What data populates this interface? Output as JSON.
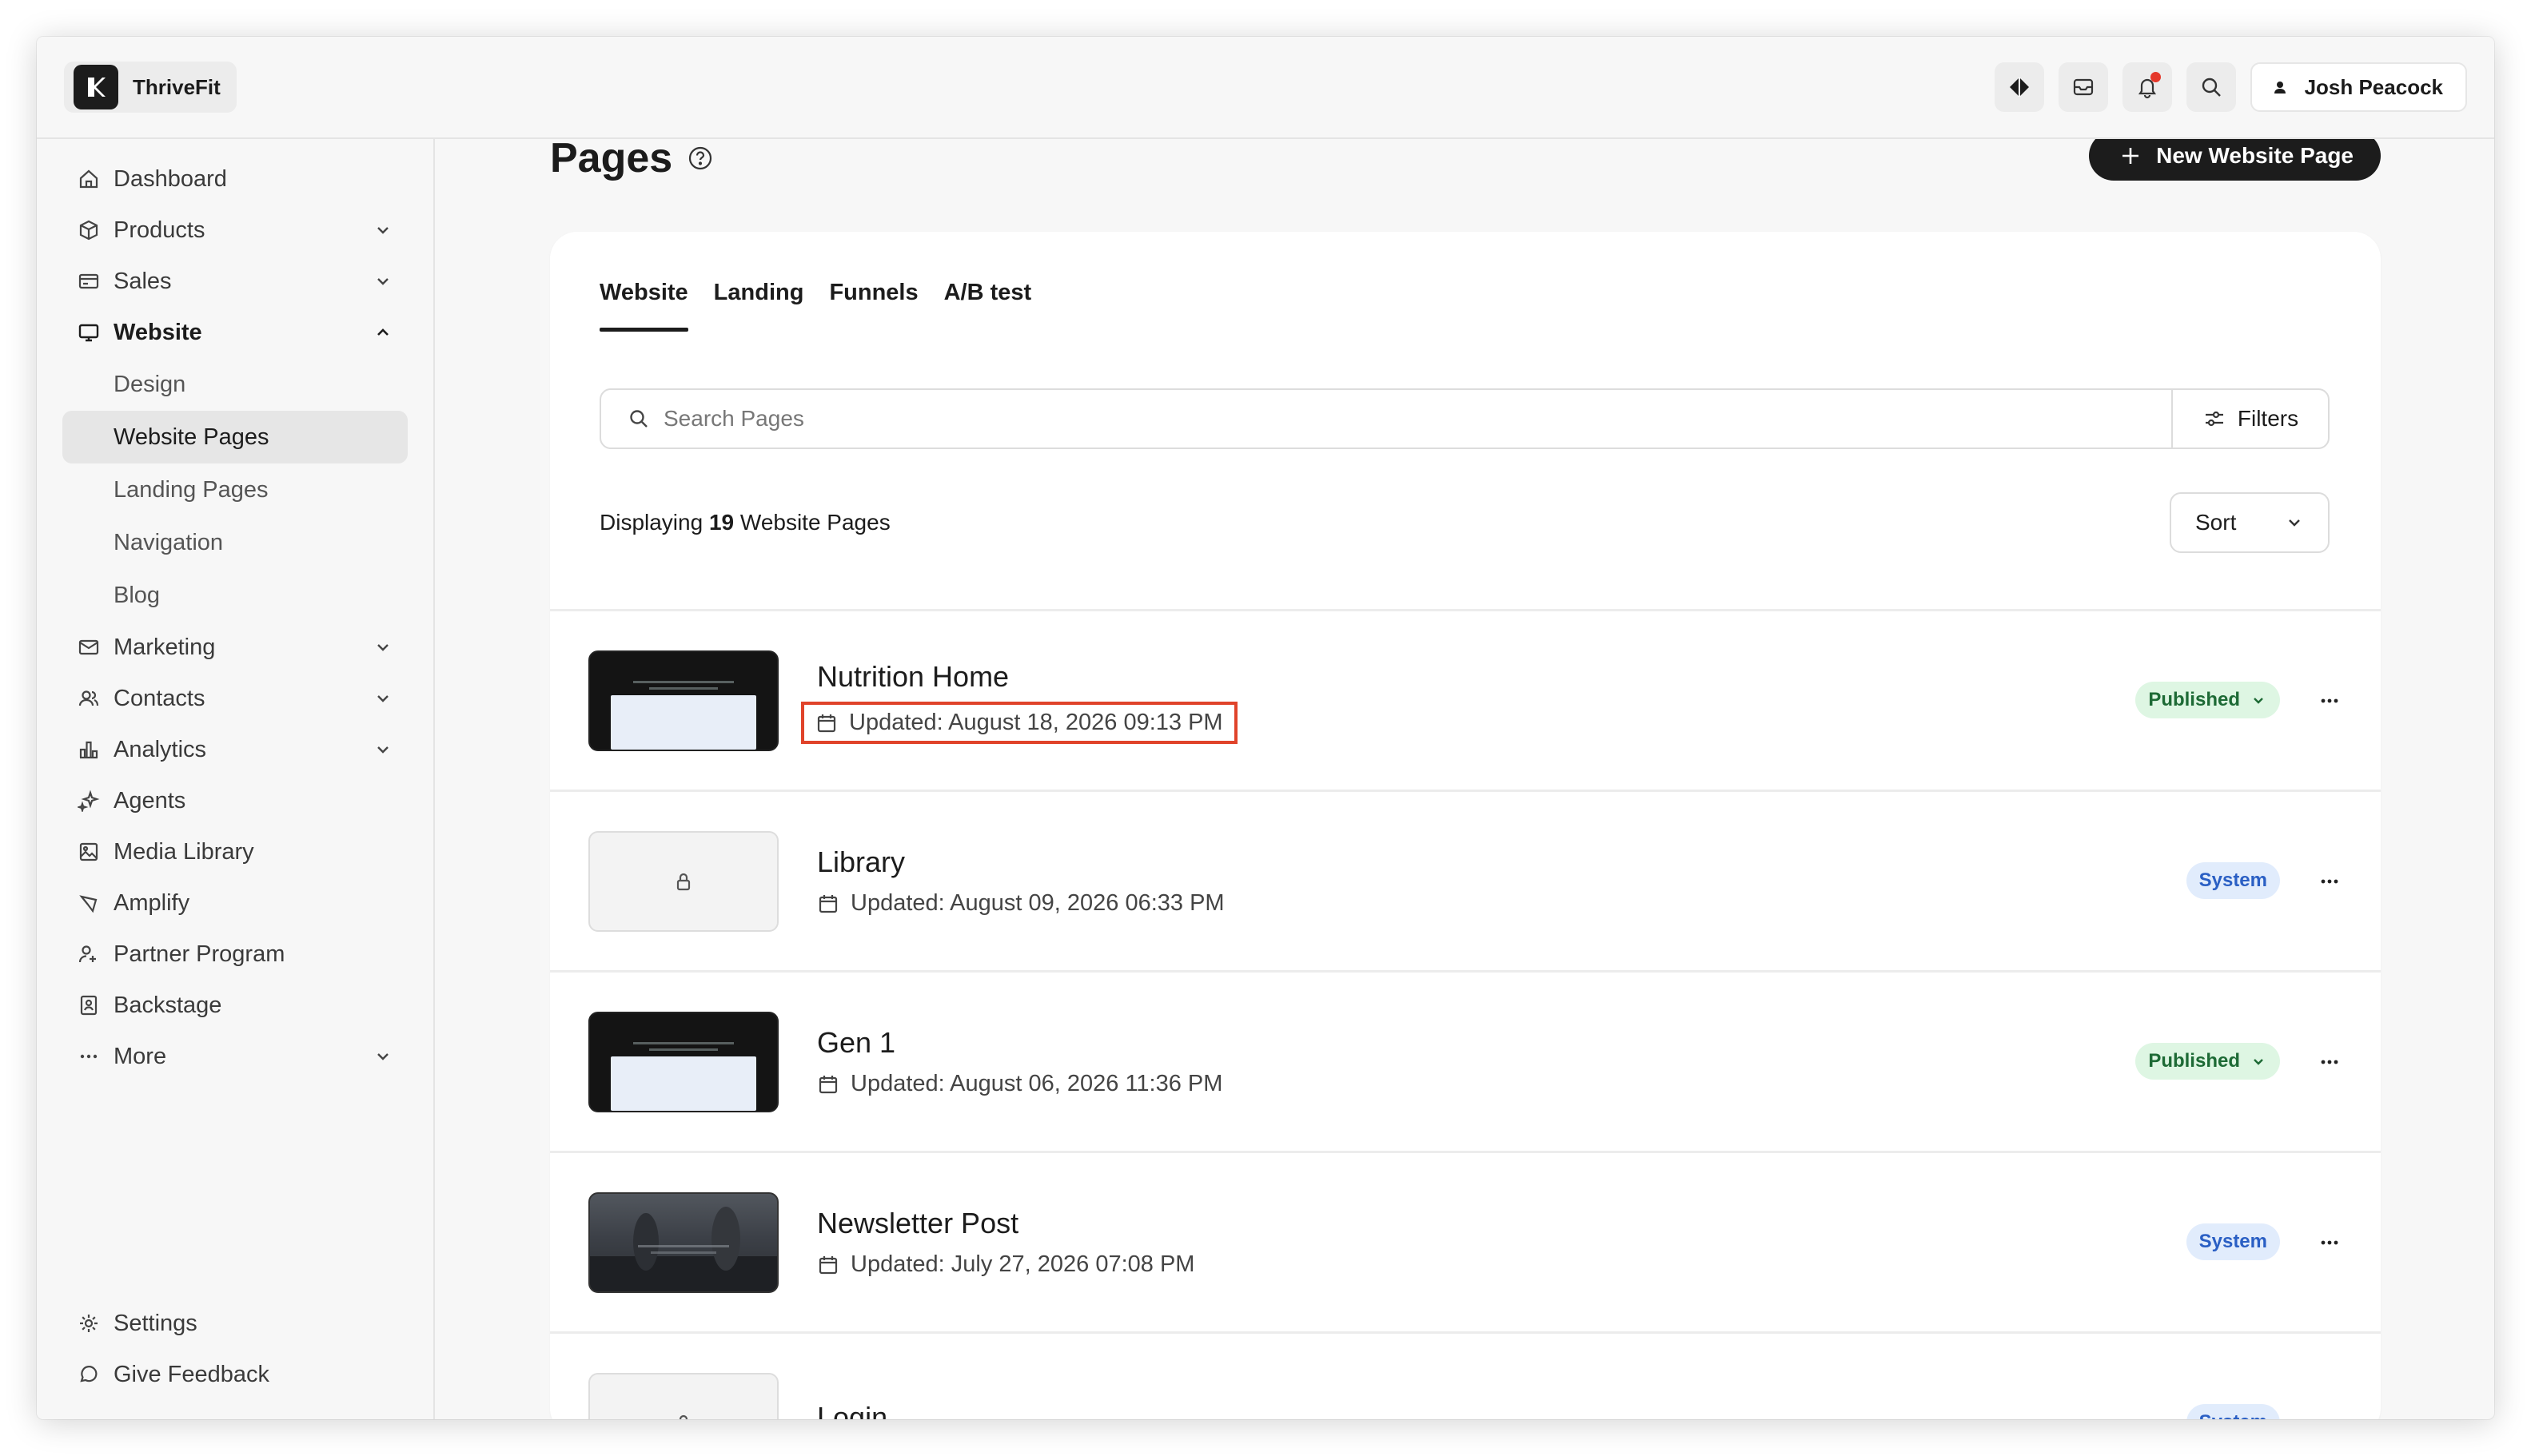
{
  "app": {
    "brand_name": "ThriveFit",
    "user_name": "Josh Peacock"
  },
  "header_icons": [
    "diamond-icon",
    "inbox-icon",
    "bell-icon",
    "search-icon"
  ],
  "sidebar": {
    "items": [
      {
        "label": "Dashboard",
        "icon": "home-icon"
      },
      {
        "label": "Products",
        "icon": "box-icon",
        "expandable": true
      },
      {
        "label": "Sales",
        "icon": "card-icon",
        "expandable": true
      },
      {
        "label": "Website",
        "icon": "monitor-icon",
        "expanded": true
      },
      {
        "label": "Marketing",
        "icon": "mail-icon",
        "expandable": true
      },
      {
        "label": "Contacts",
        "icon": "users-icon",
        "expandable": true
      },
      {
        "label": "Analytics",
        "icon": "chart-icon",
        "expandable": true
      },
      {
        "label": "Agents",
        "icon": "sparkle-icon"
      },
      {
        "label": "Media Library",
        "icon": "image-icon"
      },
      {
        "label": "Amplify",
        "icon": "megaphone-icon"
      },
      {
        "label": "Partner Program",
        "icon": "partner-icon"
      },
      {
        "label": "Backstage",
        "icon": "backstage-icon"
      },
      {
        "label": "More",
        "icon": "dots-icon",
        "expandable": true
      }
    ],
    "website_sub": [
      "Design",
      "Website Pages",
      "Landing Pages",
      "Navigation",
      "Blog"
    ],
    "active_sub": "Website Pages",
    "bottom": [
      {
        "label": "Settings",
        "icon": "gear-icon"
      },
      {
        "label": "Give Feedback",
        "icon": "chat-icon"
      }
    ]
  },
  "main": {
    "title": "Pages",
    "new_button": "New Website Page",
    "tabs": [
      "Website",
      "Landing",
      "Funnels",
      "A/B test"
    ],
    "active_tab": "Website",
    "search": {
      "placeholder": "Search Pages",
      "value": ""
    },
    "filters_label": "Filters",
    "display": {
      "prefix": "Displaying",
      "count": "19",
      "suffix": "Website Pages"
    },
    "sort_label": "Sort"
  },
  "pages": [
    {
      "title": "Nutrition Home",
      "updated": "Updated: August 18, 2026 09:13 PM",
      "status": "Published",
      "thumb": "dark",
      "highlighted": true
    },
    {
      "title": "Library",
      "updated": "Updated: August 09, 2026 06:33 PM",
      "status": "System",
      "thumb": "lock"
    },
    {
      "title": "Gen 1",
      "updated": "Updated: August 06, 2026 11:36 PM",
      "status": "Published",
      "thumb": "dark"
    },
    {
      "title": "Newsletter Post",
      "updated": "Updated: July 27, 2026 07:08 PM",
      "status": "System",
      "thumb": "photo"
    },
    {
      "title": "Login",
      "updated": "",
      "status": "System",
      "thumb": "lock"
    }
  ],
  "colors": {
    "accent_dark": "#1c1c1c",
    "published_bg": "#def6e3",
    "system_bg": "#e1ecfc",
    "highlight": "#e0432a"
  }
}
